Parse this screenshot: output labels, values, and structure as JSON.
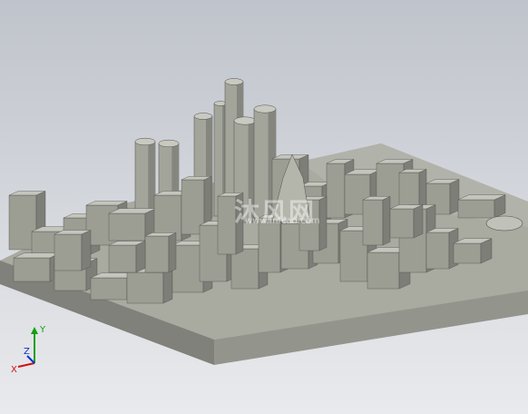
{
  "viewport": {
    "background_top": "#bfc3cb",
    "background_bottom": "#e9eaed",
    "model_color": "#a5a69c",
    "model_top_color": "#b7b8ae",
    "model_dark_color": "#6e706a"
  },
  "watermark": {
    "logo_text": "沐风网",
    "url_text": "www.mfcad.com"
  },
  "triad": {
    "x_label": "X",
    "y_label": "Y",
    "z_label": "Z",
    "x_color": "#d01010",
    "y_color": "#10a010",
    "z_color": "#1030d0"
  }
}
